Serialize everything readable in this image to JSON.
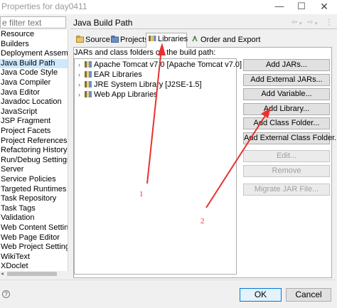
{
  "window": {
    "title": "Properties for day0411",
    "min_glyph": "—",
    "max_glyph": "☐",
    "close_glyph": "✕"
  },
  "filter": {
    "placeholder": "e filter text"
  },
  "left_nav": {
    "items": [
      "Resource",
      "Builders",
      "Deployment Assem",
      "Java Build Path",
      "Java Code Style",
      "Java Compiler",
      "Java Editor",
      "Javadoc Location",
      "JavaScript",
      "JSP Fragment",
      "Project Facets",
      "Project References",
      "Refactoring History",
      "Run/Debug Settings",
      "Server",
      "Service Policies",
      "Targeted Runtimes",
      "Task Repository",
      "Task Tags",
      "Validation",
      "Web Content Settin",
      "Web Page Editor",
      "Web Project Setting",
      "WikiText",
      "XDoclet"
    ],
    "selected_index": 3,
    "scroll_arrow": "◂"
  },
  "panel": {
    "title": "Java Build Path",
    "nav_glyphs": {
      "back": "⇦",
      "back_drop": "▾",
      "fwd": "⇨",
      "fwd_drop": "▾",
      "menu": "⋮"
    }
  },
  "tabs": [
    {
      "label": "Source",
      "icon": "source-folder-icon"
    },
    {
      "label": "Projects",
      "icon": "projects-icon"
    },
    {
      "label": "Libraries",
      "icon": "libraries-icon",
      "active": true
    },
    {
      "label": "Order and Export",
      "icon": "order-export-icon"
    }
  ],
  "jars_label": "JARs and class folders on the build path:",
  "jar_tree": {
    "items": [
      {
        "label": "Apache Tomcat v7.0 [Apache Tomcat v7.0]"
      },
      {
        "label": "EAR Libraries"
      },
      {
        "label": "JRE System Library [J2SE-1.5]"
      },
      {
        "label": "Web App Libraries"
      }
    ],
    "expand_glyph": "›"
  },
  "buttons": [
    {
      "label": "Add JARs...",
      "enabled": true
    },
    {
      "label": "Add External JARs...",
      "enabled": true
    },
    {
      "label": "Add Variable...",
      "enabled": true
    },
    {
      "label": "Add Library...",
      "enabled": true
    },
    {
      "label": "Add Class Folder...",
      "enabled": true
    },
    {
      "label": "Add External Class Folder...",
      "enabled": true
    },
    {
      "label": "Edit...",
      "enabled": false
    },
    {
      "label": "Remove",
      "enabled": false
    },
    {
      "label": "Migrate JAR File...",
      "enabled": false
    }
  ],
  "footer": {
    "help_glyph": "?",
    "ok_label": "OK",
    "cancel_label": "Cancel"
  },
  "annotations": {
    "label_1": "1",
    "label_2": "2",
    "color": "#e8312f"
  }
}
